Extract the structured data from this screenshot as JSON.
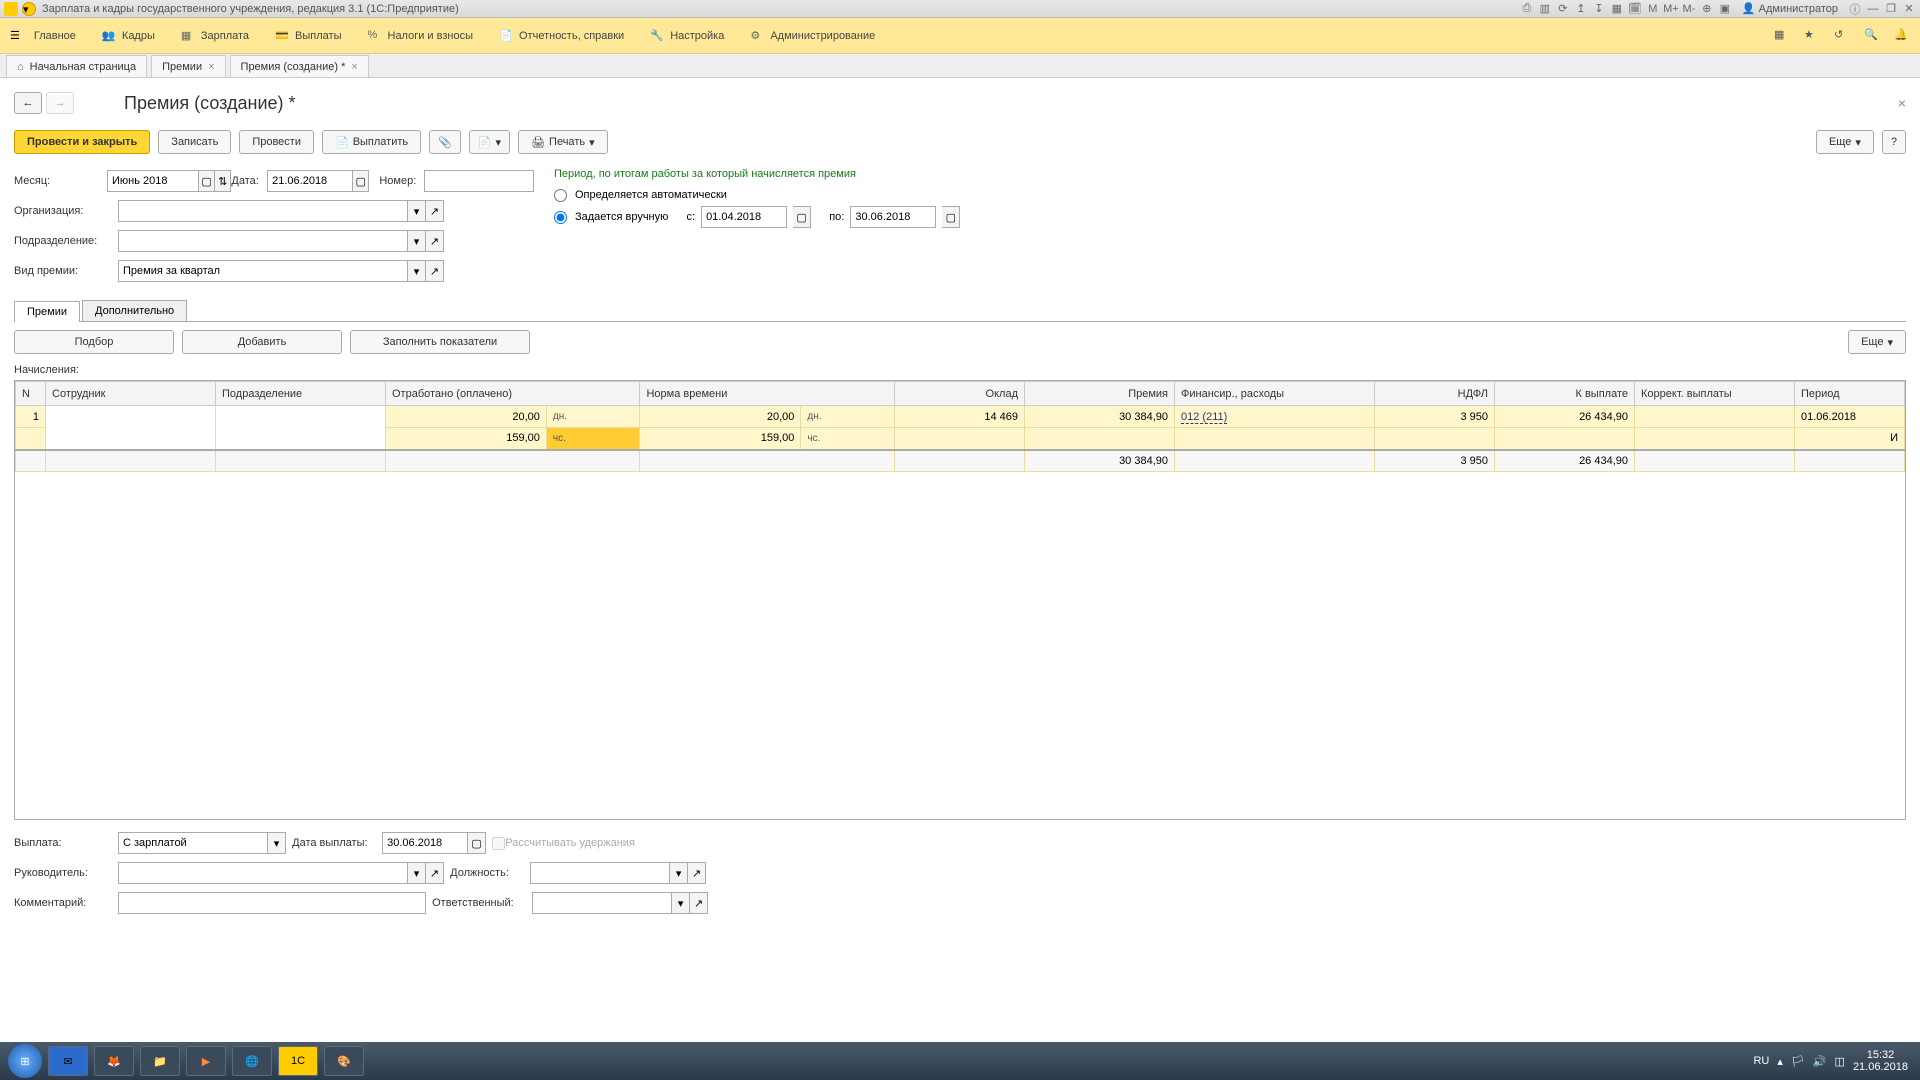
{
  "title_bar": {
    "app_title": "Зарплата и кадры государственного учреждения, редакция 3.1 (1С:Предприятие)",
    "admin": "Администратор"
  },
  "sections": [
    "Главное",
    "Кадры",
    "Зарплата",
    "Выплаты",
    "Налоги и взносы",
    "Отчетность, справки",
    "Настройка",
    "Администрирование"
  ],
  "tabs": {
    "home": "Начальная страница",
    "t1": "Премии",
    "t2": "Премия (создание) *"
  },
  "page": {
    "title": "Премия (создание) *",
    "cmd": {
      "post_close": "Провести и закрыть",
      "save": "Записать",
      "post": "Провести",
      "pay": "Выплатить",
      "print": "Печать",
      "more": "Еще"
    },
    "labels": {
      "month": "Месяц:",
      "org": "Организация:",
      "dept": "Подразделение:",
      "bonus_type": "Вид премии:",
      "date": "Дата:",
      "number": "Номер:",
      "period_note": "Период, по итогам работы за который начисляется премия",
      "auto": "Определяется автоматически",
      "manual": "Задается вручную",
      "from": "с:",
      "to": "по:",
      "accruals": "Начисления:",
      "payment": "Выплата:",
      "payment_date": "Дата выплаты:",
      "calc_deductions": "Рассчитывать удержания",
      "manager": "Руководитель:",
      "position": "Должность:",
      "comment": "Комментарий:",
      "responsible": "Ответственный:"
    },
    "values": {
      "month": "Июнь 2018",
      "date": "21.06.2018",
      "bonus_type": "Премия за квартал",
      "period_from": "01.04.2018",
      "period_to": "30.06.2018",
      "payment_mode": "С зарплатой",
      "payment_date": "30.06.2018"
    },
    "inner_tabs": [
      "Премии",
      "Дополнительно"
    ],
    "tbl_buttons": {
      "pick": "Подбор",
      "add": "Добавить",
      "fill": "Заполнить показатели",
      "more": "Еще"
    },
    "columns": [
      "N",
      "Сотрудник",
      "Подразделение",
      "Отработано (оплачено)",
      "Норма времени",
      "Оклад",
      "Премия",
      "Финансир., расходы",
      "НДФЛ",
      "К выплате",
      "Коррект. выплаты",
      "Период"
    ],
    "row": {
      "n": "1",
      "worked_days": "20,00",
      "worked_days_u": "дн.",
      "worked_hours": "159,00",
      "worked_hours_u": "чс.",
      "norm_days": "20,00",
      "norm_days_u": "дн.",
      "norm_hours": "159,00",
      "norm_hours_u": "чс.",
      "salary": "14 469",
      "bonus": "30 384,90",
      "finance": "012 (211)",
      "ndfl": "3 950",
      "to_pay": "26 434,90",
      "period": "01.06.2018",
      "tail": "И"
    },
    "totals": {
      "bonus": "30 384,90",
      "ndfl": "3 950",
      "to_pay": "26 434,90"
    }
  },
  "taskbar": {
    "lang": "RU",
    "time": "15:32",
    "date": "21.06.2018"
  }
}
